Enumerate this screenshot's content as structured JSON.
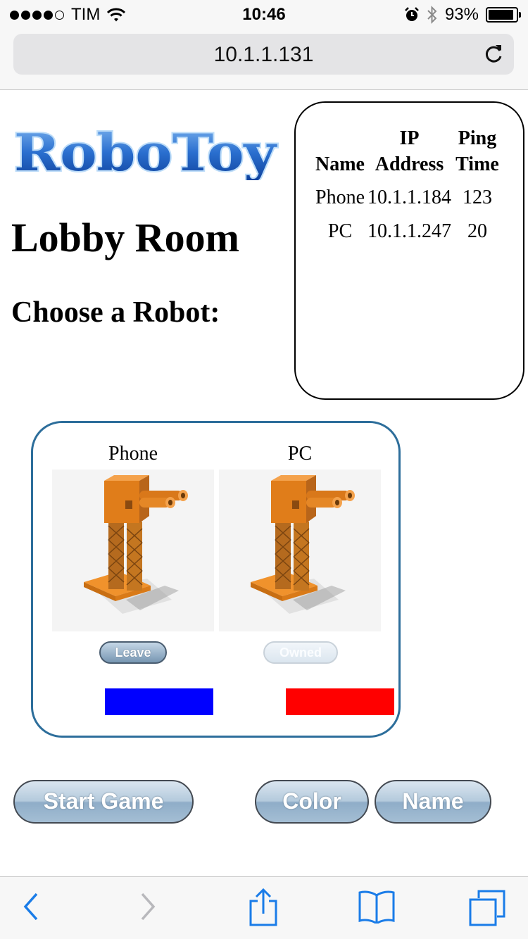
{
  "status_bar": {
    "carrier": "TIM",
    "time": "10:46",
    "battery": "93%",
    "battery_level": 0.93,
    "signal_bars": 4
  },
  "browser": {
    "url": "10.1.1.131"
  },
  "page": {
    "logo_text": "RoboToy",
    "title": "Lobby Room",
    "subtitle": "Choose a Robot:"
  },
  "players": {
    "headers": {
      "name": "Name",
      "ip": "IP Address",
      "ping": "Ping Time"
    },
    "rows": [
      {
        "name": "Phone",
        "ip": "10.1.1.184",
        "ping": "123"
      },
      {
        "name": "PC",
        "ip": "10.1.1.247",
        "ping": "20"
      }
    ]
  },
  "robots": [
    {
      "name": "Phone",
      "button": "Leave",
      "color": "#0000ff"
    },
    {
      "name": "PC",
      "button": "Owned",
      "color": "#ff0000"
    }
  ],
  "actions": {
    "start_game": "Start Game",
    "color": "Color",
    "name": "Name"
  },
  "colors": {
    "robot_box_border": "#2d6e9b",
    "link_blue": "#1a7ce8"
  },
  "icons": [
    "wifi-icon",
    "reload-icon",
    "alarm-icon",
    "bluetooth-icon",
    "back-icon",
    "forward-icon",
    "share-icon",
    "bookmarks-icon",
    "tabs-icon"
  ]
}
